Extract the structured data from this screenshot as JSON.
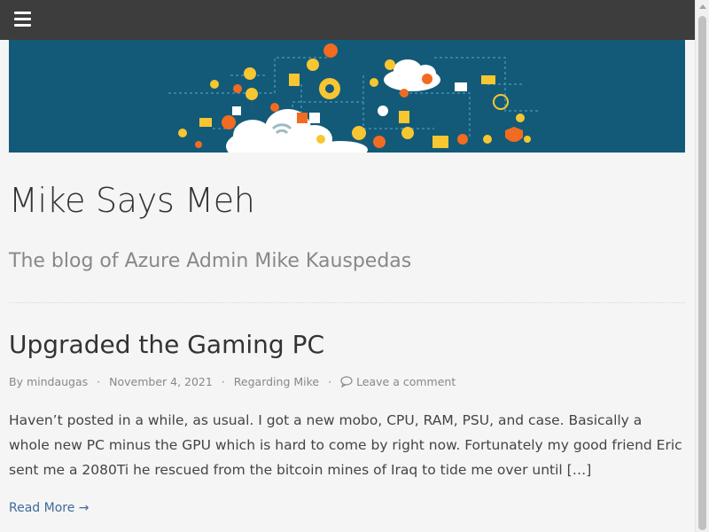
{
  "header": {
    "menu_icon": "hamburger-menu-icon",
    "bar_color": "#3d3d3d"
  },
  "banner": {
    "background_color": "#135a78",
    "icons": [
      "gear-icon",
      "cloud-icon",
      "lightbulb-icon",
      "lock-icon",
      "calendar-icon",
      "chart-icon",
      "shield-icon",
      "wifi-icon",
      "location-pin-icon",
      "mail-icon",
      "phone-icon",
      "cart-icon",
      "briefcase-icon"
    ]
  },
  "site": {
    "title": "Mike Says Meh",
    "description": "The blog of Azure Admin Mike Kauspedas"
  },
  "post": {
    "title": "Upgraded the Gaming PC",
    "by_label": "By",
    "author": "mindaugas",
    "date": "November 4, 2021",
    "category": "Regarding Mike",
    "comment_label": "Leave a comment",
    "separator": "·",
    "excerpt": "Haven’t posted in a while, as usual. I got a new mobo, CPU, RAM, PSU, and case. Basically a whole new PC minus the GPU which is hard to come by right now. Fortunately my good friend Eric sent me a 2080Ti he rescued from the bitcoin mines of Iraq to tide me over until […]",
    "read_more": "Read More →"
  },
  "colors": {
    "link": "#3f6a9b",
    "meta": "#888888",
    "banner_accent_orange": "#f26b21",
    "banner_accent_yellow": "#f7c631"
  }
}
